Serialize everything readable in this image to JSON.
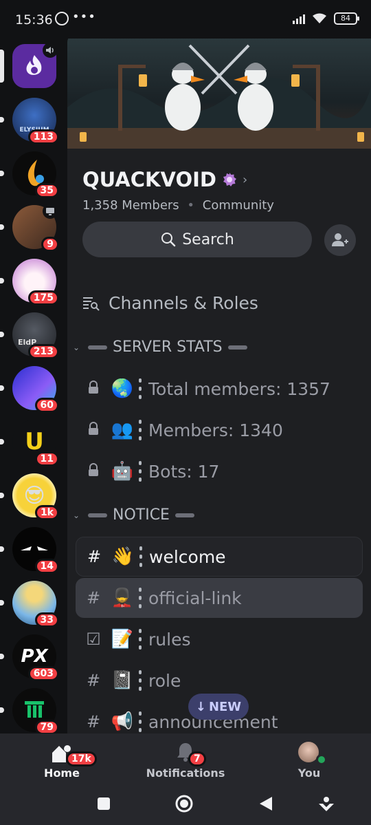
{
  "status_bar": {
    "time": "15:36",
    "battery": "84",
    "more": "•••"
  },
  "servers": [
    {
      "name": "selected-server",
      "badge": "",
      "color": "#5b2ba0"
    },
    {
      "name": "elysium",
      "badge": "113",
      "color": "#1f3a6e"
    },
    {
      "name": "flame",
      "badge": "35",
      "color": "#0b0b0b"
    },
    {
      "name": "legend",
      "badge": "9",
      "color": "#6a4b3a"
    },
    {
      "name": "unicorn",
      "badge": "175",
      "color": "#d8a6e0"
    },
    {
      "name": "eldp",
      "badge": "213",
      "color": "#2c2f36"
    },
    {
      "name": "nft",
      "badge": "60",
      "color": "#3b3ea8"
    },
    {
      "name": "u-coin",
      "badge": "11",
      "color": "#111214"
    },
    {
      "name": "cool-face",
      "badge": "1k",
      "color": "#f4c21a"
    },
    {
      "name": "eyes",
      "badge": "14",
      "color": "#050505"
    },
    {
      "name": "cloud",
      "badge": "33",
      "color": "#6ab0e6"
    },
    {
      "name": "px",
      "badge": "603",
      "color": "#0b0b0b"
    },
    {
      "name": "pillar",
      "badge": "79",
      "color": "#0b0b0b"
    }
  ],
  "server": {
    "name": "QUACKVOID",
    "members": "1,358 Members",
    "dot": "•",
    "type": "Community",
    "search_label": "Search"
  },
  "channels_roles": "Channels & Roles",
  "categories": {
    "stats": "SERVER STATS",
    "notice": "NOTICE"
  },
  "stat_channels": [
    {
      "emoji": "🌏",
      "label": "Total members: 1357"
    },
    {
      "emoji": "👥",
      "label": "Members: 1340"
    },
    {
      "emoji": "🤖",
      "label": "Bots: 17"
    }
  ],
  "notice_channels": [
    {
      "prefix": "#",
      "emoji": "👋",
      "label": "welcome"
    },
    {
      "prefix": "#",
      "emoji": "💂",
      "label": "official-link"
    },
    {
      "prefix": "☑",
      "emoji": "📝",
      "label": "rules"
    },
    {
      "prefix": "#",
      "emoji": "📓",
      "label": "role"
    },
    {
      "prefix": "#",
      "emoji": "📢",
      "label": "announcement"
    }
  ],
  "new_pill": {
    "arrow": "↓",
    "label": "NEW"
  },
  "bottom_nav": {
    "home": {
      "label": "Home",
      "badge": "17k"
    },
    "notifications": {
      "label": "Notifications",
      "badge": "7"
    },
    "you": {
      "label": "You"
    }
  },
  "colors": {
    "accent": "#5865f2",
    "badge": "#f23f43",
    "online": "#23a55a"
  }
}
